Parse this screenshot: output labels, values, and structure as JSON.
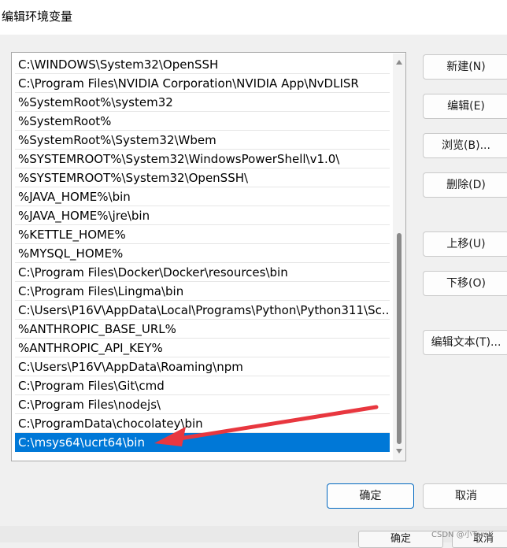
{
  "window": {
    "title": "编辑环境变量"
  },
  "paths": [
    "C:\\WINDOWS\\System32\\OpenSSH",
    "C:\\Program Files\\NVIDIA Corporation\\NVIDIA App\\NvDLISR",
    "%SystemRoot%\\system32",
    "%SystemRoot%",
    "%SystemRoot%\\System32\\Wbem",
    "%SYSTEMROOT%\\System32\\WindowsPowerShell\\v1.0\\",
    "%SYSTEMROOT%\\System32\\OpenSSH\\",
    "%JAVA_HOME%\\bin",
    "%JAVA_HOME%\\jre\\bin",
    "%KETTLE_HOME%",
    "%MYSQL_HOME%",
    "C:\\Program Files\\Docker\\Docker\\resources\\bin",
    "C:\\Program Files\\Lingma\\bin",
    "C:\\Users\\P16V\\AppData\\Local\\Programs\\Python\\Python311\\Sc...",
    "%ANTHROPIC_BASE_URL%",
    "%ANTHROPIC_API_KEY%",
    "C:\\Users\\P16V\\AppData\\Roaming\\npm",
    "C:\\Program Files\\Git\\cmd",
    "C:\\Program Files\\nodejs\\",
    "C:\\ProgramData\\chocolatey\\bin",
    "C:\\msys64\\ucrt64\\bin"
  ],
  "selected_path": "C:\\msys64\\ucrt64\\bin",
  "buttons": {
    "new": "新建(N)",
    "edit": "编辑(E)",
    "browse": "浏览(B)...",
    "delete": "删除(D)",
    "move_up": "上移(U)",
    "move_down": "下移(O)",
    "edit_text": "编辑文本(T)...",
    "ok": "确定",
    "cancel": "取消"
  },
  "background_window": {
    "ok": "确定",
    "cancel": "取消"
  },
  "watermark": "CSDN @小TomK",
  "colors": {
    "selection": "#0078d7",
    "arrow": "#e8373f"
  }
}
